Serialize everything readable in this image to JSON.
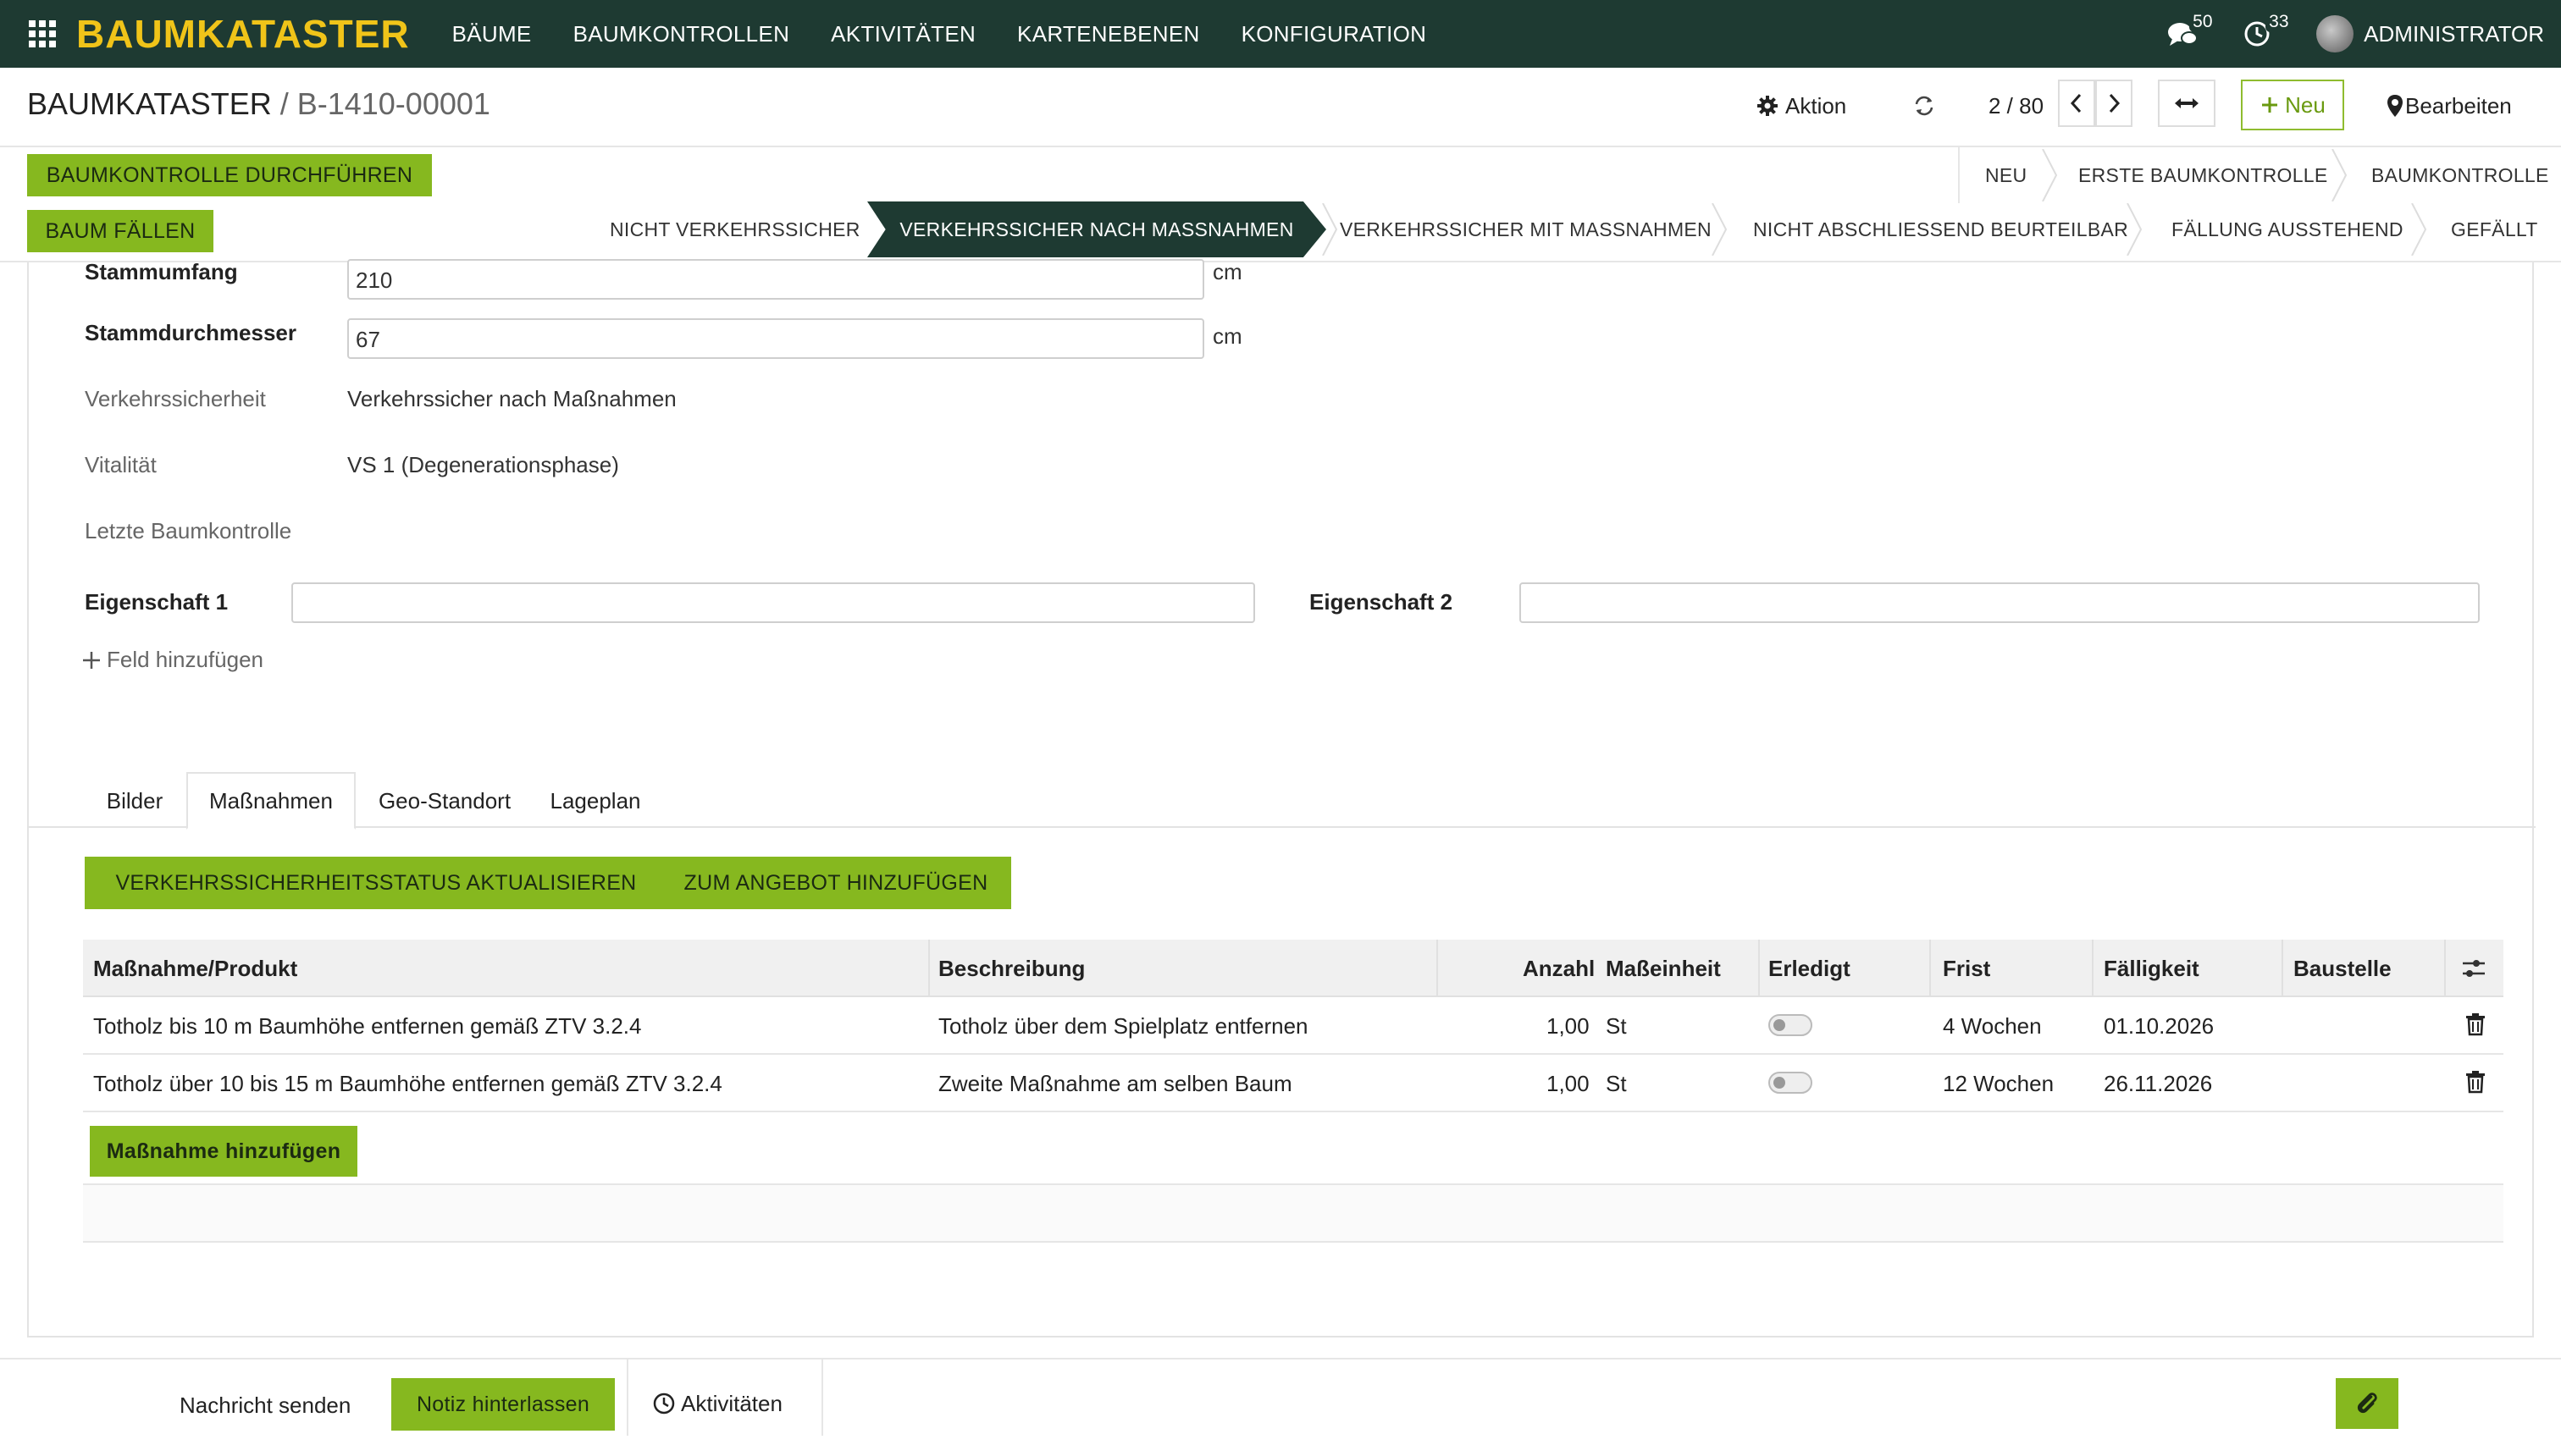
{
  "nav": {
    "brand": "BAUMKATASTER",
    "menu": [
      "BÄUME",
      "BAUMKONTROLLEN",
      "AKTIVITÄTEN",
      "KARTENEBENEN",
      "KONFIGURATION"
    ],
    "messages_count": "50",
    "activities_count": "33",
    "user": "ADMINISTRATOR"
  },
  "control": {
    "breadcrumb_root": "BAUMKATASTER",
    "breadcrumb_sep": " / ",
    "breadcrumb_current": "B-1410-00001",
    "action_label": "Aktion",
    "pager": "2 / 80",
    "new_label": "Neu",
    "edit_label": "Bearbeiten"
  },
  "statusbar": {
    "btn_control": "BAUMKONTROLLE DURCHFÜHREN",
    "btn_fell": "BAUM FÄLLEN",
    "top_stages": [
      "NEU",
      "ERSTE BAUMKONTROLLE",
      "BAUMKONTROLLE"
    ],
    "stages": [
      "NICHT VERKEHRSSICHER",
      "VERKEHRSSICHER NACH MASSNAHMEN",
      "VERKEHRSSICHER MIT MASSNAHMEN",
      "NICHT ABSCHLIESSEND BEURTEILBAR",
      "FÄLLUNG AUSSTEHEND",
      "GEFÄLLT"
    ],
    "active_stage_index": 1
  },
  "form": {
    "stammumfang_label": "Stammumfang",
    "stammumfang_value": "210",
    "stammdurchmesser_label": "Stammdurchmesser",
    "stammdurchmesser_value": "67",
    "unit": "cm",
    "verkehrssicherheit_label": "Verkehrssicherheit",
    "verkehrssicherheit_value": "Verkehrssicher nach Maßnahmen",
    "vitalitaet_label": "Vitalität",
    "vitalitaet_value": "VS 1 (Degenerationsphase)",
    "letzte_label": "Letzte Baumkontrolle",
    "eigenschaft1_label": "Eigenschaft 1",
    "eigenschaft2_label": "Eigenschaft 2",
    "add_field": "Feld hinzufügen"
  },
  "tabs": [
    "Bilder",
    "Maßnahmen",
    "Geo-Standort",
    "Lageplan"
  ],
  "active_tab": "Maßnahmen",
  "measures": {
    "btn_update": "VERKEHRSSICHERHEITSSTATUS AKTUALISIEREN",
    "btn_offer": "ZUM ANGEBOT HINZUFÜGEN",
    "columns": [
      "Maßnahme/Produkt",
      "Beschreibung",
      "Anzahl",
      "Maßeinheit",
      "Erledigt",
      "Frist",
      "Fälligkeit",
      "Baustelle"
    ],
    "rows": [
      {
        "produkt": "Totholz bis 10 m Baumhöhe entfernen gemäß ZTV 3.2.4",
        "beschreibung": "Totholz über dem Spielplatz entfernen",
        "anzahl": "1,00",
        "einheit": "St",
        "erledigt": false,
        "frist": "4 Wochen",
        "faelligkeit": "01.10.2026",
        "baustelle": ""
      },
      {
        "produkt": "Totholz über 10 bis 15 m Baumhöhe entfernen gemäß ZTV 3.2.4",
        "beschreibung": "Zweite Maßnahme am selben Baum",
        "anzahl": "1,00",
        "einheit": "St",
        "erledigt": false,
        "frist": "12 Wochen",
        "faelligkeit": "26.11.2026",
        "baustelle": ""
      }
    ],
    "add_label": "Maßnahme hinzufügen"
  },
  "chatter": {
    "send": "Nachricht senden",
    "note": "Notiz hinterlassen",
    "activities": "Aktivitäten"
  },
  "colors": {
    "navbar": "#1e3a32",
    "brand": "#f0c419",
    "accent": "#86b81f"
  }
}
